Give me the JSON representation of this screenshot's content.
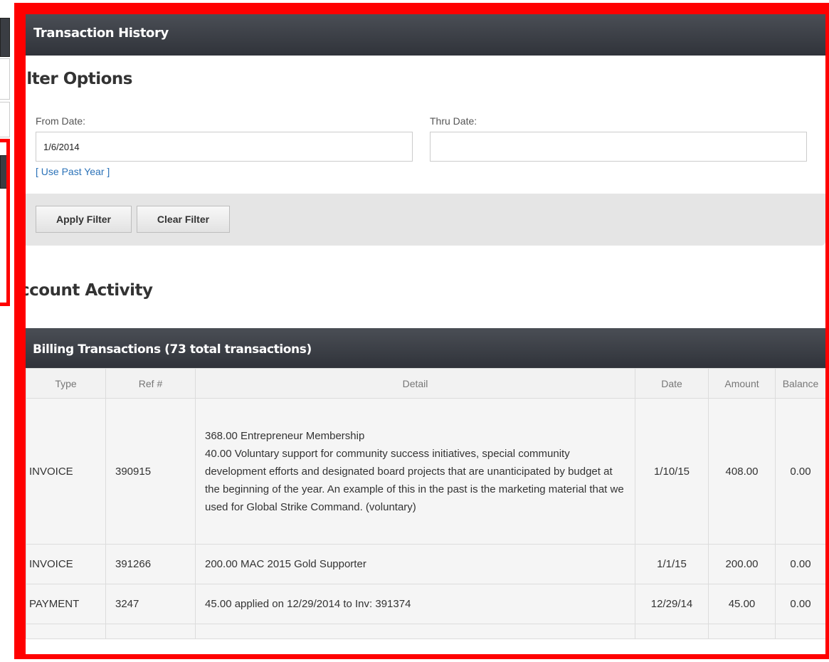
{
  "panel": {
    "title": "Transaction History"
  },
  "filter": {
    "heading": "ilter Options",
    "from_label": "From Date:",
    "from_value": "1/6/2014",
    "thru_label": "Thru Date:",
    "thru_value": "",
    "past_year_link": "[ Use Past Year ]",
    "apply_label": "Apply Filter",
    "clear_label": "Clear Filter"
  },
  "activity": {
    "heading": "ccount Activity",
    "table_title": "Billing Transactions (73 total transactions)",
    "columns": [
      "Type",
      "Ref #",
      "Detail",
      "Date",
      "Amount",
      "Balance"
    ],
    "rows": [
      {
        "type": "INVOICE",
        "ref": "390915",
        "detail_lines": [
          "368.00 Entrepreneur Membership",
          "40.00 Voluntary support for community success initiatives, special community development efforts and designated board projects that are unanticipated by budget at the beginning of the year. An example of this in the past is the marketing material that we used for Global Strike Command. (voluntary)"
        ],
        "date": "1/10/15",
        "amount": "408.00",
        "balance": "0.00"
      },
      {
        "type": "INVOICE",
        "ref": "391266",
        "detail_lines": [
          "200.00 MAC 2015 Gold Supporter"
        ],
        "date": "1/1/15",
        "amount": "200.00",
        "balance": "0.00"
      },
      {
        "type": "PAYMENT",
        "ref": "3247",
        "detail_lines": [
          "45.00 applied on 12/29/2014 to Inv: 391374"
        ],
        "date": "12/29/14",
        "amount": "45.00",
        "balance": "0.00"
      }
    ]
  },
  "colors": {
    "header_bg": "#3a3d43",
    "highlight": "#ff0000",
    "link": "#2b72b8"
  }
}
